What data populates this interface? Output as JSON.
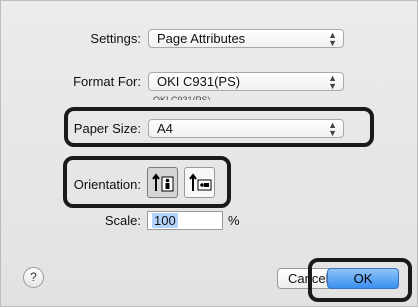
{
  "settings": {
    "label": "Settings:",
    "value": "Page Attributes"
  },
  "format_for": {
    "label": "Format For:",
    "value": "OKI C931(PS)",
    "subtitle": "OKI C931(PS)"
  },
  "paper_size": {
    "label": "Paper Size:",
    "value": "A4"
  },
  "orientation": {
    "label": "Orientation:"
  },
  "scale": {
    "label": "Scale:",
    "value": "100",
    "unit": "%"
  },
  "help": {
    "label": "?"
  },
  "buttons": {
    "cancel": "Cancel",
    "ok": "OK"
  }
}
